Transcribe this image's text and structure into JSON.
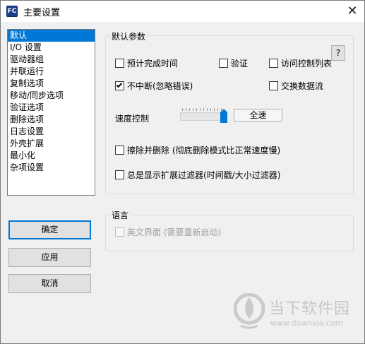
{
  "window": {
    "app_icon_text": "FC",
    "title": "主要设置",
    "close_glyph": "✕"
  },
  "sidebar": {
    "items": [
      {
        "label": "默认",
        "selected": true
      },
      {
        "label": "I/O 设置"
      },
      {
        "label": "驱动器组"
      },
      {
        "label": "并联运行"
      },
      {
        "label": "复制选项"
      },
      {
        "label": "移动/同步选项"
      },
      {
        "label": "验证选项"
      },
      {
        "label": "删除选项"
      },
      {
        "label": "日志设置"
      },
      {
        "label": "外壳扩展"
      },
      {
        "label": "最小化"
      },
      {
        "label": "杂项设置"
      }
    ]
  },
  "buttons": {
    "ok": "确定",
    "apply": "应用",
    "cancel": "取消"
  },
  "defaults_group": {
    "label": "默认参数",
    "help": "?",
    "options": {
      "estimate_time": {
        "label": "预计完成时间",
        "checked": false
      },
      "verify": {
        "label": "验证",
        "checked": false
      },
      "acl": {
        "label": "访问控制列表",
        "checked": false
      },
      "no_interrupt": {
        "label": "不中断(忽略错误)",
        "checked": true
      },
      "streams": {
        "label": "交换数据流",
        "checked": false
      },
      "wipe_delete": {
        "label": "擦除并删除 (彻底删除模式比正常速度慢)",
        "checked": false
      },
      "show_filter": {
        "label": "总是显示扩展过滤器(时间戳/大小过滤器)",
        "checked": false
      }
    },
    "speed": {
      "label": "速度控制",
      "level": 1.0,
      "value": "全速"
    }
  },
  "language_group": {
    "label": "语言",
    "english_ui": {
      "label": "英文界面 (需要重新启动)",
      "checked": false,
      "disabled": true
    }
  },
  "watermark": {
    "name": "当下软件园",
    "url": "www.downxia.com"
  },
  "colors": {
    "accent": "#0078d7",
    "selection": "#0078d7"
  }
}
